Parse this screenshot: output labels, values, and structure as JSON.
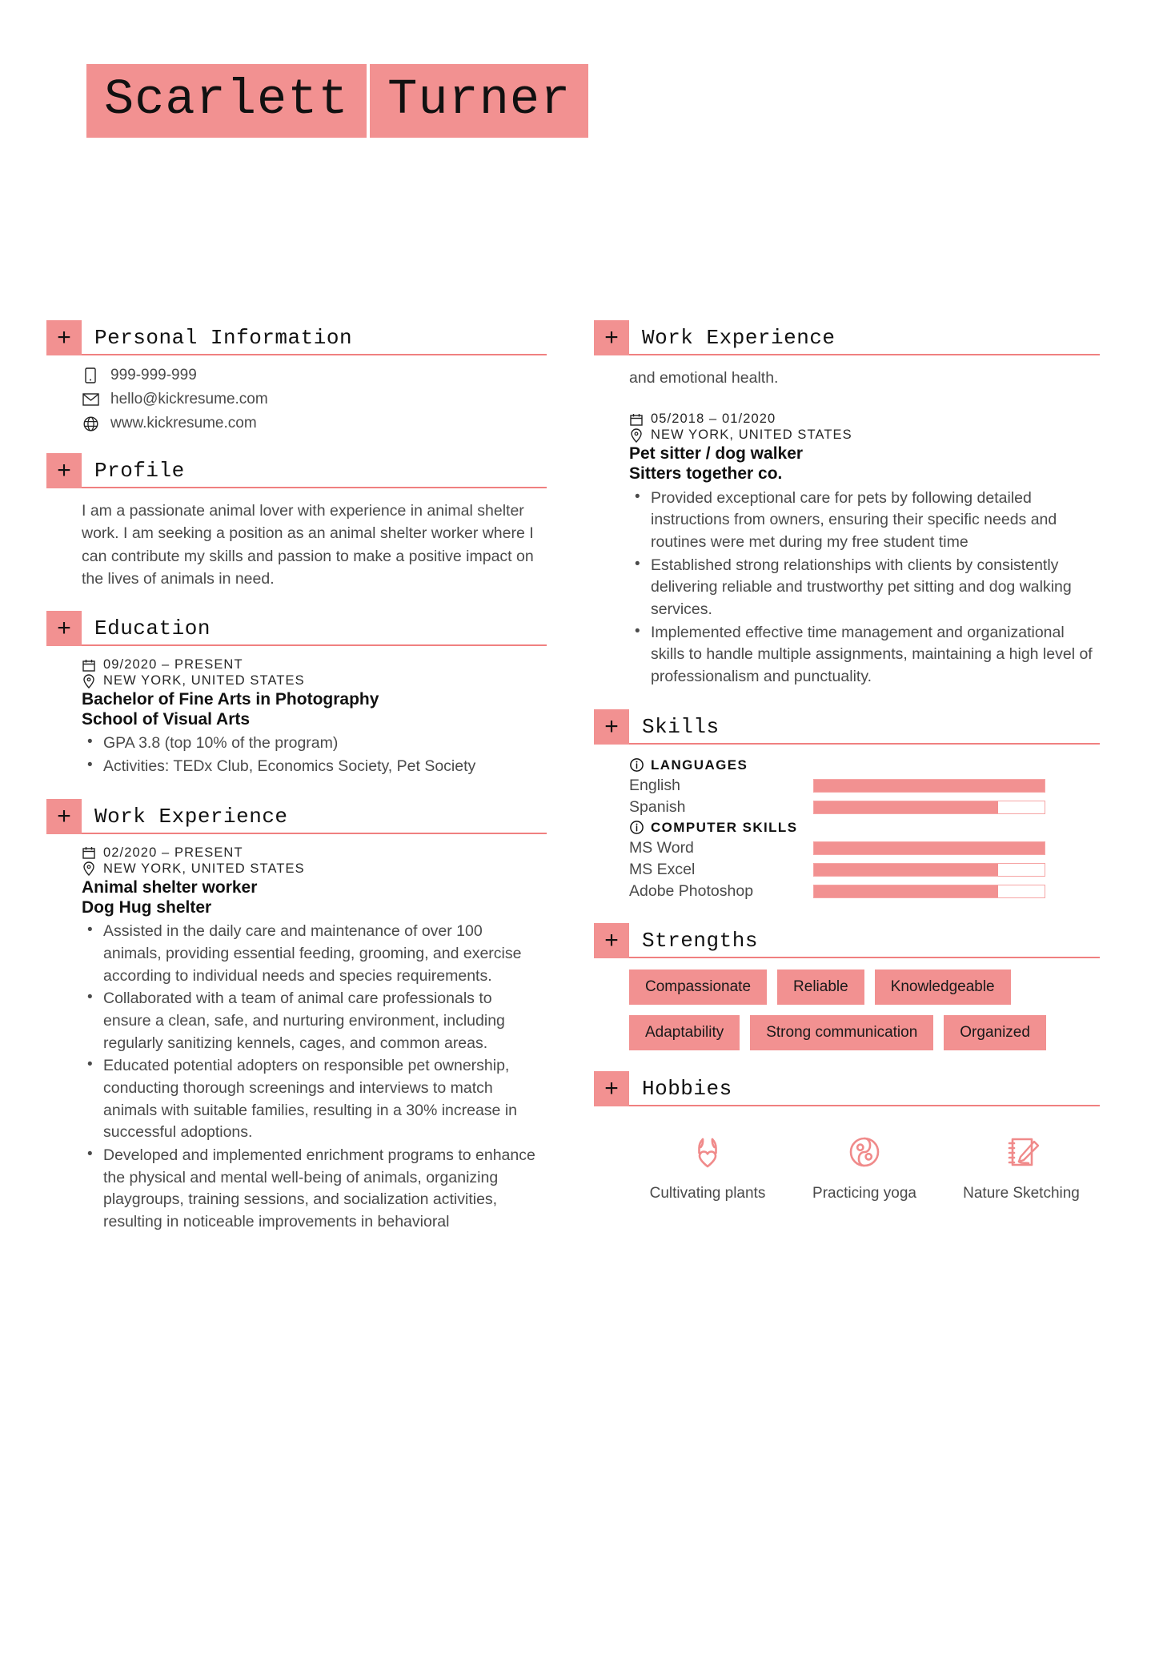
{
  "theme": {
    "accent": "#F29191",
    "accent_rule": "#F08080",
    "text": "#4a4a4a",
    "heading": "#111111"
  },
  "header": {
    "first_name": "Scarlett",
    "last_name": "Turner"
  },
  "sections": {
    "personal_information": {
      "title": "Personal Information",
      "plus": "+",
      "contacts": [
        {
          "icon": "phone-icon",
          "value": "999-999-999"
        },
        {
          "icon": "email-icon",
          "value": "hello@kickresume.com"
        },
        {
          "icon": "globe-icon",
          "value": "www.kickresume.com"
        }
      ]
    },
    "profile": {
      "title": "Profile",
      "plus": "+",
      "text": "I am a passionate animal lover with experience in animal shelter work. I am seeking a position as an animal shelter worker where I can contribute my skills and passion to make a positive impact on the lives of animals in need."
    },
    "education": {
      "title": "Education",
      "plus": "+",
      "entries": [
        {
          "date": "09/2020 – PRESENT",
          "location": "NEW YORK, UNITED STATES",
          "title": "Bachelor of Fine Arts in Photography",
          "organization": "School of Visual Arts",
          "bullets": [
            "GPA 3.8 (top 10% of the program)",
            "Activities: TEDx Club, Economics Society, Pet Society"
          ]
        }
      ]
    },
    "work_experience_left": {
      "title": "Work Experience",
      "plus": "+",
      "entries": [
        {
          "date": "02/2020 – PRESENT",
          "location": "NEW YORK, UNITED STATES",
          "title": "Animal shelter worker",
          "organization": "Dog Hug shelter",
          "bullets": [
            "Assisted in the daily care and maintenance of over 100 animals, providing essential feeding, grooming, and exercise according to individual needs and species requirements.",
            "Collaborated with a team of animal care professionals to ensure a clean, safe, and nurturing environment, including regularly sanitizing kennels, cages, and common areas.",
            "Educated potential adopters on responsible pet ownership, conducting thorough screenings and interviews to match animals with suitable families, resulting in a 30% increase in successful adoptions.",
            "Developed and implemented enrichment programs to enhance the physical and mental well-being of animals, organizing playgroups, training sessions, and socialization activities, resulting in noticeable improvements in behavioral"
          ]
        }
      ]
    },
    "work_experience_right": {
      "title": "Work Experience",
      "plus": "+",
      "continuation_text": "and emotional health.",
      "entries": [
        {
          "date": "05/2018 – 01/2020",
          "location": "NEW YORK, UNITED STATES",
          "title": "Pet sitter / dog walker",
          "organization": "Sitters together co.",
          "bullets": [
            "Provided exceptional care for pets by following detailed instructions from owners, ensuring their specific needs and routines were met during my free student time",
            "Established strong relationships with clients by consistently delivering reliable and trustworthy pet sitting and dog walking services.",
            "Implemented effective time management and organizational skills to handle multiple assignments, maintaining a high level of professionalism and punctuality."
          ]
        }
      ]
    },
    "skills": {
      "title": "Skills",
      "plus": "+",
      "groups": [
        {
          "label": "LANGUAGES",
          "icon": "info-icon",
          "items": [
            {
              "name": "English",
              "level": 100
            },
            {
              "name": "Spanish",
              "level": 80
            }
          ]
        },
        {
          "label": "COMPUTER SKILLS",
          "icon": "info-icon",
          "items": [
            {
              "name": "MS Word",
              "level": 100
            },
            {
              "name": "MS Excel",
              "level": 80
            },
            {
              "name": "Adobe Photoshop",
              "level": 80
            }
          ]
        }
      ]
    },
    "strengths": {
      "title": "Strengths",
      "plus": "+",
      "tags": [
        "Compassionate",
        "Reliable",
        "Knowledgeable",
        "Adaptability",
        "Strong communication",
        "Organized"
      ]
    },
    "hobbies": {
      "title": "Hobbies",
      "plus": "+",
      "items": [
        {
          "icon": "hands-heart-icon",
          "label": "Cultivating plants"
        },
        {
          "icon": "yin-yang-icon",
          "label": "Practicing yoga"
        },
        {
          "icon": "sketchbook-pen-icon",
          "label": "Nature Sketching"
        }
      ]
    }
  }
}
